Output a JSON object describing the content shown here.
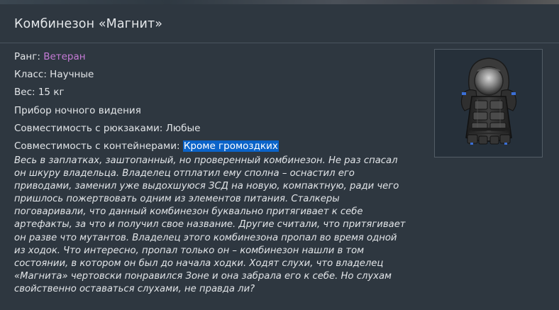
{
  "item": {
    "title": "Комбинезон «Магнит»",
    "properties": [
      {
        "label": "Ранг: ",
        "value": "Ветеран"
      },
      {
        "label": "Класс: ",
        "value": "Научные"
      },
      {
        "label": "Вес: ",
        "value": "15 кг"
      },
      {
        "label": "",
        "value": "Прибор ночного видения"
      },
      {
        "label": "Совместимость с рюкзаками: ",
        "value": "Любые"
      },
      {
        "label": "Совместимость с контейнерами: ",
        "value": "Кроме громоздких"
      }
    ],
    "description": "Весь в заплатках, заштопанный, но проверенный комбинезон. Не раз спасал\nон шкуру владельца. Владелец отплатил ему сполна – оснастил его\nприводами, заменил уже выдохшуюся ЗСД на новую, компактную, ради чего\nпришлось пожертвовать одним из элементов питания. Сталкеры\nпоговаривали, что данный комбинезон буквально притягивает к себе\nартефакты, за что и получил свое название. Другие считали, что притягивает\nон разве что мутантов. Владелец этого комбинезона пропал во время одной\nиз ходок. Что интересно, пропал только он – комбинезон нашли в том\nсостоянии, в котором он был до начала ходки. Ходят слухи, что владелец\n«Магнита» чертовски понравился Зоне и она забрала его к себе. Но слухам\nсвойственно оставаться слухами, не правда ли?"
  },
  "colors": {
    "background": "#2e3740",
    "rank_value": "#c57bd6",
    "selection": "#0a63c9",
    "text": "#e2e5e8"
  },
  "icons": {
    "item_image": "suit-image"
  }
}
